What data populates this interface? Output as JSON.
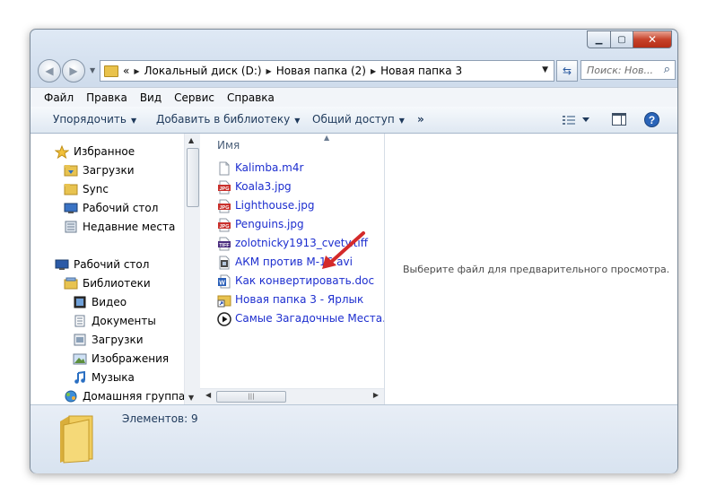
{
  "address": {
    "prefix": "«",
    "parts": [
      "Локальный диск (D:)",
      "Новая папка (2)",
      "Новая папка 3"
    ]
  },
  "search": {
    "placeholder": "Поиск: Нов..."
  },
  "menu": [
    "Файл",
    "Правка",
    "Вид",
    "Сервис",
    "Справка"
  ],
  "toolbar": {
    "organize": "Упорядочить",
    "add_to_library": "Добавить в библиотеку",
    "share": "Общий доступ",
    "more": "»"
  },
  "nav": {
    "favorites": "Избранное",
    "downloads": "Загрузки",
    "sync": "Sync",
    "desktop_fav": "Рабочий стол",
    "recent": "Недавние места",
    "desktop": "Рабочий стол",
    "libraries": "Библиотеки",
    "video": "Видео",
    "documents": "Документы",
    "lib_downloads": "Загрузки",
    "images": "Изображения",
    "music": "Музыка",
    "homegroup": "Домашняя группа"
  },
  "files": {
    "column_name": "Имя",
    "items": [
      {
        "name": "Kalimba.m4r",
        "icon": "blank-file-icon"
      },
      {
        "name": "Koala3.jpg",
        "icon": "jpg-icon"
      },
      {
        "name": "Lighthouse.jpg",
        "icon": "jpg-icon"
      },
      {
        "name": "Penguins.jpg",
        "icon": "jpg-icon"
      },
      {
        "name": "zolotnicky1913_cvety.tiff",
        "icon": "tiff-icon"
      },
      {
        "name": "АКМ против М-16.avi",
        "icon": "video-file-icon"
      },
      {
        "name": "Как конвертировать.doc",
        "icon": "word-doc-icon"
      },
      {
        "name": "Новая папка 3 - Ярлык",
        "icon": "shortcut-icon"
      },
      {
        "name": "Самые Загадочные Места.wel",
        "icon": "media-play-icon"
      }
    ]
  },
  "preview": {
    "message": "Выберите файл для предварительного просмотра."
  },
  "details": {
    "count": "Элементов: 9"
  },
  "colors": {
    "link_blue": "#1d2ecf",
    "arrow_red": "#d42a2a",
    "close_red": "#c7432b"
  }
}
